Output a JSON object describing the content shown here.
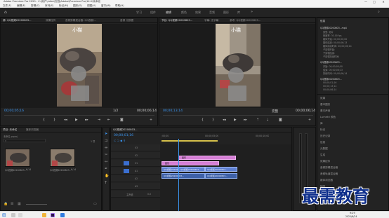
{
  "window": {
    "title": "Adobe Premiere Pro 2020 - C:\\用户\\Ldisk\\文档\\Adobe\\Premiere Pro\\14.0\\未命名",
    "minimize": "—",
    "maximize": "□",
    "close": "✕"
  },
  "menu": [
    "文件(F)",
    "编辑(E)",
    "剪辑(C)",
    "序列(S)",
    "标记(M)",
    "图形(G)",
    "视图(V)",
    "窗口(W)",
    "帮助(H)"
  ],
  "workspaces": [
    "学习",
    "组件",
    "编辑",
    "颜色",
    "效果",
    "音频",
    "图形",
    "库"
  ],
  "source_monitor": {
    "tabs": [
      "源: QQ视频20200803...",
      "效果控件",
      "音频剪辑混合器: QQ视频...",
      "音频 元数据"
    ],
    "overlay_text": "小猫",
    "timecode": "00;00;05;16",
    "duration": "00;00;06;14",
    "zoom": "1/2"
  },
  "program_monitor": {
    "tabs": [
      "节目: QQ视频20200803...",
      "字幕: 无字幕",
      "参考: QQ视频20200803..."
    ],
    "overlay_text": "小猫",
    "timecode": "00;00;13;14",
    "fit": "完整",
    "duration": "00;00;06;14"
  },
  "properties_panel": {
    "header": "信息",
    "clip_name": "QQ视频20200803...mp4",
    "meta_lines": [
      "类型: 影片",
      "帧速率: 30.00 fps",
      "媒体开始: 00;00;00;00",
      "媒体结束: 00;00;06;13",
      "媒体持续时间: 00;00;06;14",
      "子剪辑开始:",
      "子剪辑结束:",
      "子剪辑持续时间:"
    ],
    "sub_clip": "QQ视频20200803...",
    "sub_meta": [
      "开始: 00;00;00;00",
      "结束: 00;00;06;13",
      "持续时间: 00;00;06;14"
    ],
    "sequence": "QQ视频20200803...",
    "seq_meta": [
      "00;00;01;16",
      "00;00;13;14",
      "00;00;06;14"
    ],
    "sections": [
      "效果",
      "基本图形",
      "基本声音",
      "Lumetri 颜色",
      "库",
      "标记",
      "历史记录",
      "信息",
      "元数据",
      "生成",
      "效果控件",
      "音频剪辑混合器",
      "音频轨道混合器",
      "媒体浏览器",
      "捕捉"
    ]
  },
  "project_panel": {
    "tabs": [
      "项目: 未命名",
      "媒体浏览器"
    ],
    "path": "未命名.prproj",
    "count": "1 项",
    "items": [
      {
        "name": "QQ视频20200803...",
        "duration": "6;14"
      },
      {
        "name": "QQ视频20200803...",
        "duration": "6;14"
      }
    ]
  },
  "timeline": {
    "tab": "QQ视频20200803...",
    "timecode": "00;00;01;16",
    "ruler": [
      ";00;00",
      "00;00;05;00",
      "00;00;10;00"
    ],
    "tracks": [
      {
        "id": "V3",
        "label": "V3"
      },
      {
        "id": "V2",
        "label": "V2"
      },
      {
        "id": "V1",
        "label": "V1"
      },
      {
        "id": "A1",
        "label": "A1"
      },
      {
        "id": "A2",
        "label": "A2"
      },
      {
        "id": "A3",
        "label": "A3"
      },
      {
        "id": "M",
        "label": "主声道"
      }
    ],
    "clips": {
      "title_clip": "图形",
      "video_a": "QQ视频20200803...",
      "video_b": "QQ视频20200803...",
      "audio_a": "QQ视频20200803...",
      "audio_b": "QQ视频20200803..."
    },
    "master_value": "0.0"
  },
  "taskbar": {
    "time": "9:29",
    "date": "2021/6/24"
  },
  "watermark": "最需教育"
}
